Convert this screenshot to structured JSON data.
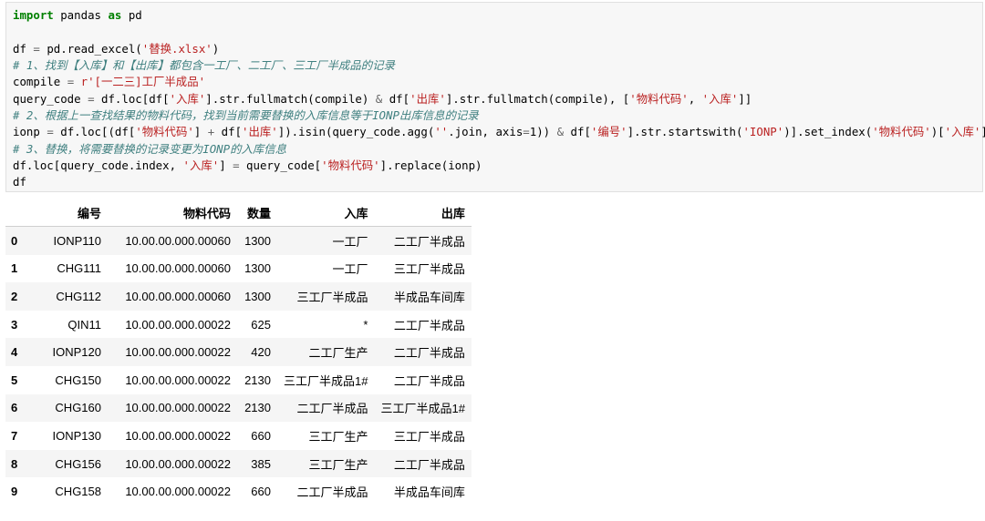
{
  "input_cell": {
    "lines": [
      [
        {
          "t": "import",
          "c": "kw"
        },
        {
          "t": " pandas "
        },
        {
          "t": "as",
          "c": "kw"
        },
        {
          "t": " pd"
        }
      ],
      [],
      [
        {
          "t": "df "
        },
        {
          "t": "=",
          "c": "op"
        },
        {
          "t": " pd.read_excel("
        },
        {
          "t": "'替换.xlsx'",
          "c": "str"
        },
        {
          "t": ")"
        }
      ],
      [
        {
          "t": "# 1、找到【入库】和【出库】都包含一工厂、二工厂、三工厂半成品的记录",
          "c": "cm"
        }
      ],
      [
        {
          "t": "compile "
        },
        {
          "t": "=",
          "c": "op"
        },
        {
          "t": " "
        },
        {
          "t": "r'[一二三]工厂半成品'",
          "c": "str"
        }
      ],
      [
        {
          "t": "query_code "
        },
        {
          "t": "=",
          "c": "op"
        },
        {
          "t": " df.loc[df["
        },
        {
          "t": "'入库'",
          "c": "str"
        },
        {
          "t": "].str.fullmatch(compile) "
        },
        {
          "t": "&",
          "c": "op"
        },
        {
          "t": " df["
        },
        {
          "t": "'出库'",
          "c": "str"
        },
        {
          "t": "].str.fullmatch(compile), ["
        },
        {
          "t": "'物料代码'",
          "c": "str"
        },
        {
          "t": ", "
        },
        {
          "t": "'入库'",
          "c": "str"
        },
        {
          "t": "]]"
        }
      ],
      [
        {
          "t": "# 2、根据上一查找结果的物料代码，找到当前需要替换的入库信息等于IONP出库信息的记录",
          "c": "cm"
        }
      ],
      [
        {
          "t": "ionp "
        },
        {
          "t": "=",
          "c": "op"
        },
        {
          "t": " df.loc[(df["
        },
        {
          "t": "'物料代码'",
          "c": "str"
        },
        {
          "t": "] "
        },
        {
          "t": "+",
          "c": "op"
        },
        {
          "t": " df["
        },
        {
          "t": "'出库'",
          "c": "str"
        },
        {
          "t": "]).isin(query_code.agg("
        },
        {
          "t": "''",
          "c": "str"
        },
        {
          "t": ".join, axis"
        },
        {
          "t": "=",
          "c": "op"
        },
        {
          "t": "1)) "
        },
        {
          "t": "&",
          "c": "op"
        },
        {
          "t": " df["
        },
        {
          "t": "'编号'",
          "c": "str"
        },
        {
          "t": "].str.startswith("
        },
        {
          "t": "'IONP'",
          "c": "str"
        },
        {
          "t": ")].set_index("
        },
        {
          "t": "'物料代码'",
          "c": "str"
        },
        {
          "t": ")["
        },
        {
          "t": "'入库'",
          "c": "str"
        },
        {
          "t": "]"
        }
      ],
      [
        {
          "t": "# 3、替换，将需要替换的记录变更为IONP的入库信息",
          "c": "cm"
        }
      ],
      [
        {
          "t": "df.loc[query_code.index, "
        },
        {
          "t": "'入库'",
          "c": "str"
        },
        {
          "t": "] "
        },
        {
          "t": "=",
          "c": "op"
        },
        {
          "t": " query_code["
        },
        {
          "t": "'物料代码'",
          "c": "str"
        },
        {
          "t": "].replace(ionp)"
        }
      ],
      [
        {
          "t": "df"
        }
      ]
    ]
  },
  "output_table": {
    "columns": [
      "",
      "编号",
      "物料代码",
      "数量",
      "入库",
      "出库"
    ],
    "rows": [
      [
        "0",
        "IONP110",
        "10.00.00.000.00060",
        "1300",
        "一工厂",
        "二工厂半成品"
      ],
      [
        "1",
        "CHG111",
        "10.00.00.000.00060",
        "1300",
        "一工厂",
        "三工厂半成品"
      ],
      [
        "2",
        "CHG112",
        "10.00.00.000.00060",
        "1300",
        "三工厂半成品",
        "半成品车间库"
      ],
      [
        "3",
        "QIN11",
        "10.00.00.000.00022",
        "625",
        "*",
        "二工厂半成品"
      ],
      [
        "4",
        "IONP120",
        "10.00.00.000.00022",
        "420",
        "二工厂生产",
        "二工厂半成品"
      ],
      [
        "5",
        "CHG150",
        "10.00.00.000.00022",
        "2130",
        "三工厂半成品1#",
        "二工厂半成品"
      ],
      [
        "6",
        "CHG160",
        "10.00.00.000.00022",
        "2130",
        "二工厂半成品",
        "三工厂半成品1#"
      ],
      [
        "7",
        "IONP130",
        "10.00.00.000.00022",
        "660",
        "三工厂生产",
        "三工厂半成品"
      ],
      [
        "8",
        "CHG156",
        "10.00.00.000.00022",
        "385",
        "三工厂生产",
        "二工厂半成品"
      ],
      [
        "9",
        "CHG158",
        "10.00.00.000.00022",
        "660",
        "二工厂半成品",
        "半成品车间库"
      ]
    ]
  }
}
